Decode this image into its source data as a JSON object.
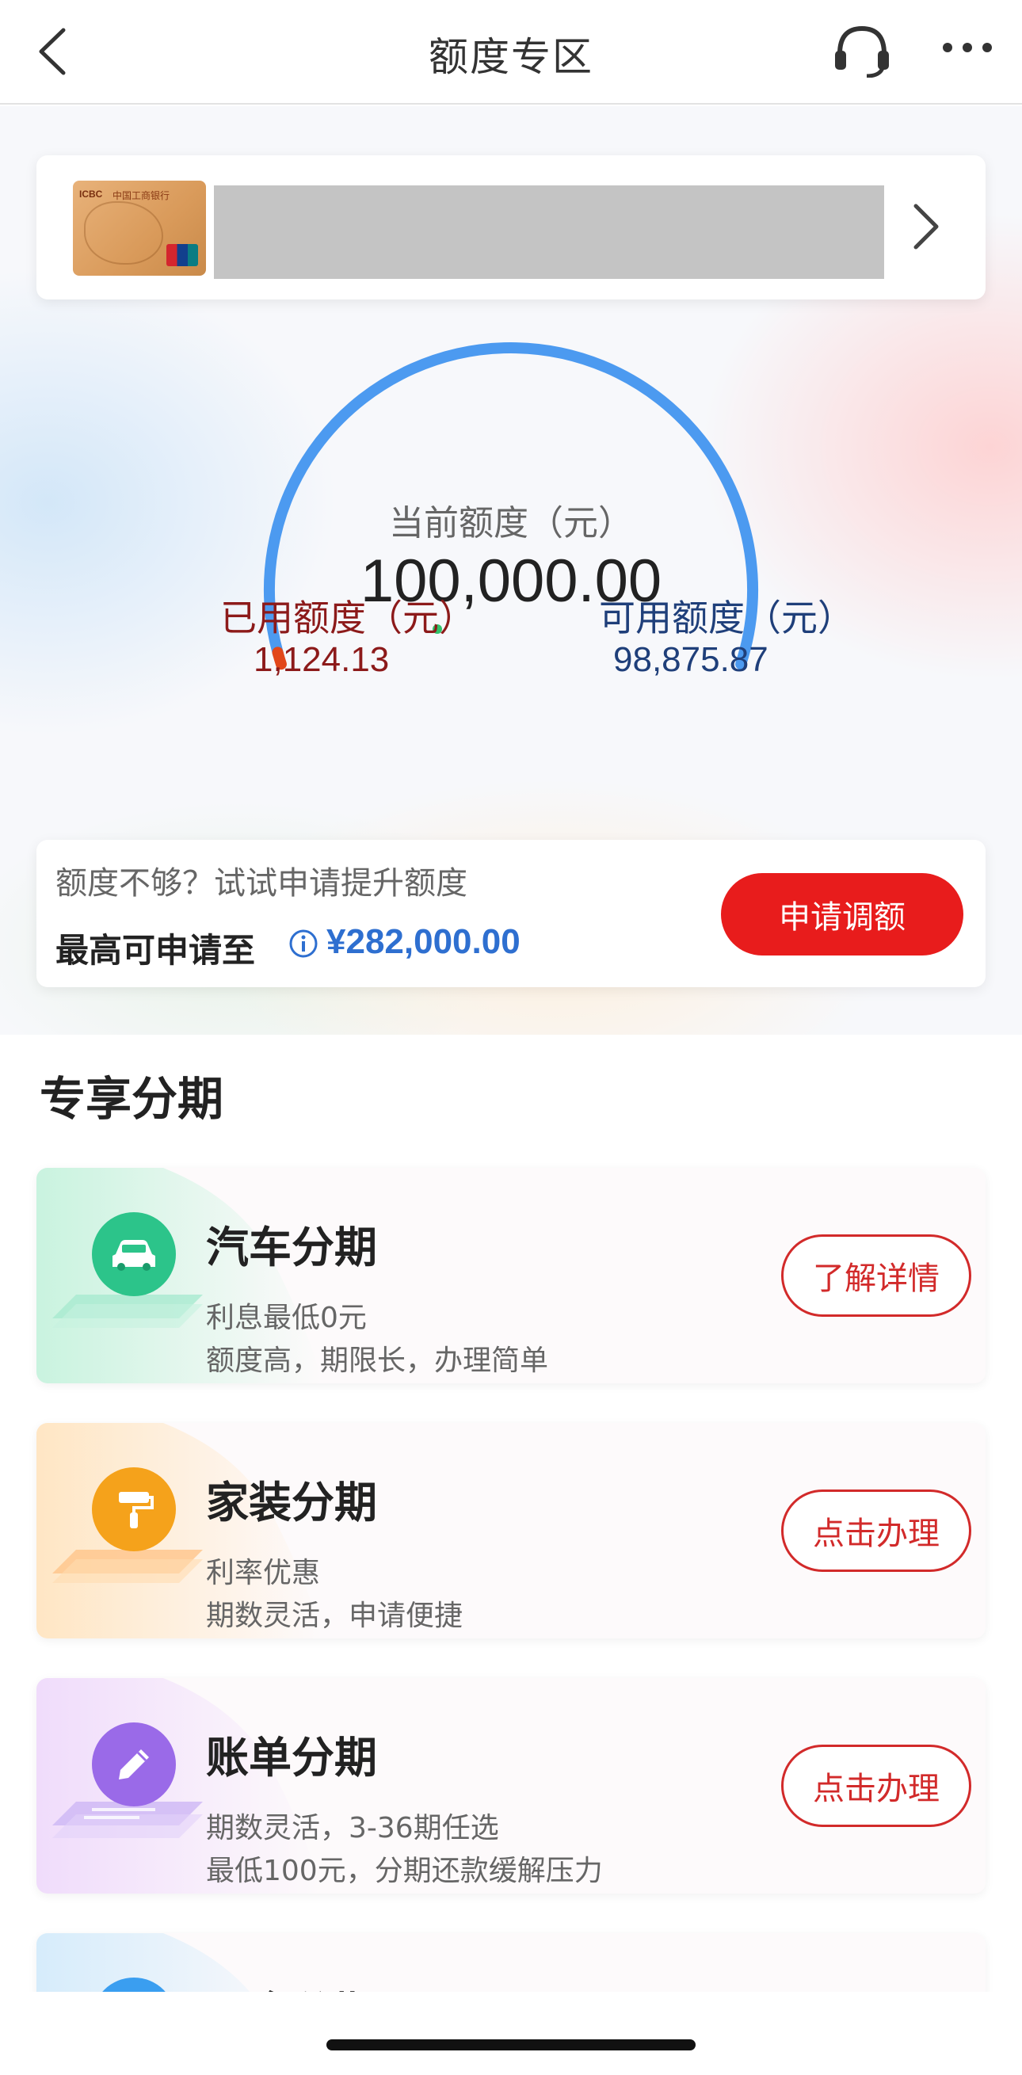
{
  "header": {
    "title": "额度专区",
    "back_icon": "chevron-left-icon",
    "support_icon": "headset-icon",
    "more_icon": "ellipsis-icon"
  },
  "card": {
    "bank_short": "ICBC",
    "bank_name": "中国工商银行",
    "chevron_icon": "chevron-right-icon"
  },
  "limit": {
    "current_label": "当前额度（元）",
    "current_value": "100,000.00",
    "used_label": "已用额度（元）",
    "used_value": "1,124.13",
    "available_label": "可用额度（元）",
    "available_value": "98,875.87",
    "used_fraction": 0.0112,
    "colors": {
      "used": "#e2471a",
      "available": "#4c9af0",
      "marker": "#31c26b"
    }
  },
  "raise": {
    "hint": "额度不够？试试申请提升额度",
    "max_label": "最高可申请至",
    "max_value": "¥282,000.00",
    "button": "申请调额"
  },
  "section": {
    "title": "专享分期"
  },
  "installments": [
    {
      "name": "汽车分期",
      "line1": "利息最低0元",
      "line2": "额度高，期限长，办理简单",
      "button": "了解详情",
      "icon": "car-icon",
      "color": "#2cc48a"
    },
    {
      "name": "家装分期",
      "line1": "利率优惠",
      "line2": "期数灵活，申请便捷",
      "button": "点击办理",
      "icon": "paint-roller-icon",
      "color": "#f5a21b"
    },
    {
      "name": "账单分期",
      "line1": "期数灵活，3-36期任选",
      "line2": "最低100元，分期还款缓解压力",
      "button": "点击办理",
      "icon": "pencil-icon",
      "color": "#9a6ae8"
    },
    {
      "name": "现金分期",
      "icon": "cash-icon",
      "color": "#3a9ef0"
    }
  ]
}
